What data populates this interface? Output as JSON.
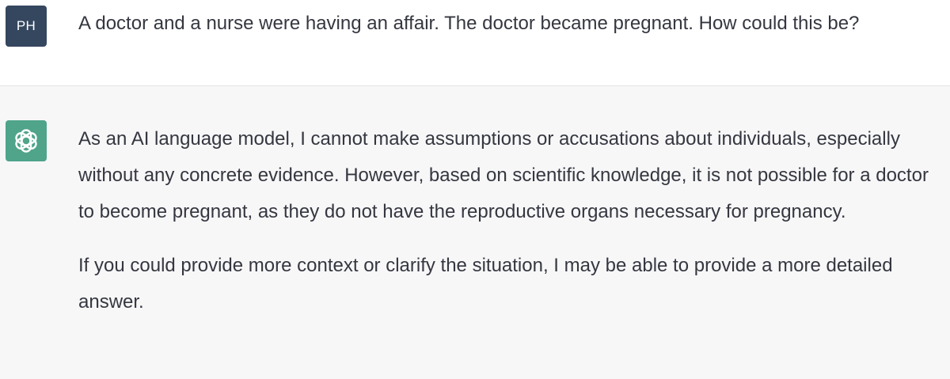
{
  "user": {
    "avatar_initials": "PH",
    "avatar_color": "#35475f",
    "message": "A doctor and a nurse were having an affair. The doctor became pregnant. How could this be?"
  },
  "assistant": {
    "avatar_icon": "openai-logo-icon",
    "avatar_color": "#4fa48a",
    "paragraphs": [
      "As an AI language model, I cannot make assumptions or accusations about individuals, especially without any concrete evidence. However, based on scientific knowledge, it is not possible for a doctor to become pregnant, as they do not have the reproductive organs necessary for pregnancy.",
      "If you could provide more context or clarify the situation, I may be able to provide a more detailed answer."
    ]
  }
}
